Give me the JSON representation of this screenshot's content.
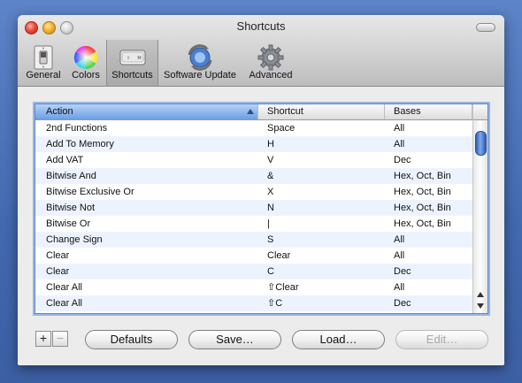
{
  "window": {
    "title": "Shortcuts"
  },
  "toolbar": {
    "items": [
      {
        "label": "General",
        "icon": "light-switch-icon"
      },
      {
        "label": "Colors",
        "icon": "color-wheel-icon"
      },
      {
        "label": "Shortcuts",
        "icon": "keyboard-key-icon",
        "selected": true
      },
      {
        "label": "Software Update",
        "icon": "software-update-icon"
      },
      {
        "label": "Advanced",
        "icon": "gear-icon"
      }
    ]
  },
  "table": {
    "columns": [
      "Action",
      "Shortcut",
      "Bases"
    ],
    "sorted_column": "Action",
    "rows": [
      {
        "action": "2nd Functions",
        "shortcut": "Space",
        "bases": "All"
      },
      {
        "action": "Add To Memory",
        "shortcut": "H",
        "bases": "All"
      },
      {
        "action": "Add VAT",
        "shortcut": "V",
        "bases": "Dec"
      },
      {
        "action": "Bitwise And",
        "shortcut": "&",
        "bases": "Hex, Oct, Bin"
      },
      {
        "action": "Bitwise Exclusive Or",
        "shortcut": "X",
        "bases": "Hex, Oct, Bin"
      },
      {
        "action": "Bitwise Not",
        "shortcut": "N",
        "bases": "Hex, Oct, Bin"
      },
      {
        "action": "Bitwise Or",
        "shortcut": "|",
        "bases": "Hex, Oct, Bin"
      },
      {
        "action": "Change Sign",
        "shortcut": "S",
        "bases": "All"
      },
      {
        "action": "Clear",
        "shortcut": "Clear",
        "bases": "All"
      },
      {
        "action": "Clear",
        "shortcut": "C",
        "bases": "Dec"
      },
      {
        "action": "Clear All",
        "shortcut": "⇧Clear",
        "bases": "All"
      },
      {
        "action": "Clear All",
        "shortcut": "⇧C",
        "bases": "Dec"
      }
    ]
  },
  "buttons": {
    "add": "+",
    "remove": "−",
    "defaults": "Defaults",
    "save": "Save…",
    "load": "Load…",
    "edit": "Edit…"
  },
  "colors": {
    "selection_blue": "#6c9ee4",
    "alt_row": "#edf3fe",
    "desktop": "#4a6fb5"
  }
}
